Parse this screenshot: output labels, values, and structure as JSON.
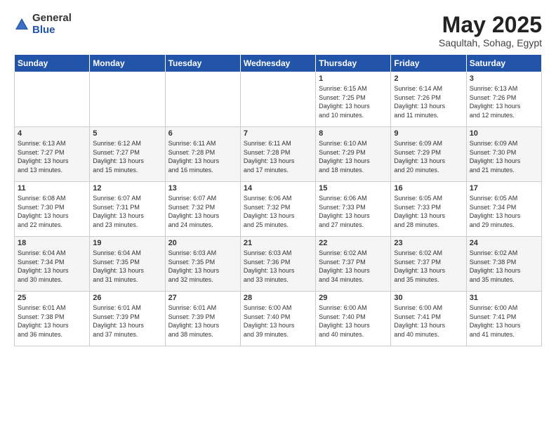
{
  "logo": {
    "general": "General",
    "blue": "Blue"
  },
  "header": {
    "title": "May 2025",
    "location": "Saqultah, Sohag, Egypt"
  },
  "days_of_week": [
    "Sunday",
    "Monday",
    "Tuesday",
    "Wednesday",
    "Thursday",
    "Friday",
    "Saturday"
  ],
  "weeks": [
    [
      {
        "num": "",
        "info": ""
      },
      {
        "num": "",
        "info": ""
      },
      {
        "num": "",
        "info": ""
      },
      {
        "num": "",
        "info": ""
      },
      {
        "num": "1",
        "info": "Sunrise: 6:15 AM\nSunset: 7:25 PM\nDaylight: 13 hours\nand 10 minutes."
      },
      {
        "num": "2",
        "info": "Sunrise: 6:14 AM\nSunset: 7:26 PM\nDaylight: 13 hours\nand 11 minutes."
      },
      {
        "num": "3",
        "info": "Sunrise: 6:13 AM\nSunset: 7:26 PM\nDaylight: 13 hours\nand 12 minutes."
      }
    ],
    [
      {
        "num": "4",
        "info": "Sunrise: 6:13 AM\nSunset: 7:27 PM\nDaylight: 13 hours\nand 13 minutes."
      },
      {
        "num": "5",
        "info": "Sunrise: 6:12 AM\nSunset: 7:27 PM\nDaylight: 13 hours\nand 15 minutes."
      },
      {
        "num": "6",
        "info": "Sunrise: 6:11 AM\nSunset: 7:28 PM\nDaylight: 13 hours\nand 16 minutes."
      },
      {
        "num": "7",
        "info": "Sunrise: 6:11 AM\nSunset: 7:28 PM\nDaylight: 13 hours\nand 17 minutes."
      },
      {
        "num": "8",
        "info": "Sunrise: 6:10 AM\nSunset: 7:29 PM\nDaylight: 13 hours\nand 18 minutes."
      },
      {
        "num": "9",
        "info": "Sunrise: 6:09 AM\nSunset: 7:29 PM\nDaylight: 13 hours\nand 20 minutes."
      },
      {
        "num": "10",
        "info": "Sunrise: 6:09 AM\nSunset: 7:30 PM\nDaylight: 13 hours\nand 21 minutes."
      }
    ],
    [
      {
        "num": "11",
        "info": "Sunrise: 6:08 AM\nSunset: 7:30 PM\nDaylight: 13 hours\nand 22 minutes."
      },
      {
        "num": "12",
        "info": "Sunrise: 6:07 AM\nSunset: 7:31 PM\nDaylight: 13 hours\nand 23 minutes."
      },
      {
        "num": "13",
        "info": "Sunrise: 6:07 AM\nSunset: 7:32 PM\nDaylight: 13 hours\nand 24 minutes."
      },
      {
        "num": "14",
        "info": "Sunrise: 6:06 AM\nSunset: 7:32 PM\nDaylight: 13 hours\nand 25 minutes."
      },
      {
        "num": "15",
        "info": "Sunrise: 6:06 AM\nSunset: 7:33 PM\nDaylight: 13 hours\nand 27 minutes."
      },
      {
        "num": "16",
        "info": "Sunrise: 6:05 AM\nSunset: 7:33 PM\nDaylight: 13 hours\nand 28 minutes."
      },
      {
        "num": "17",
        "info": "Sunrise: 6:05 AM\nSunset: 7:34 PM\nDaylight: 13 hours\nand 29 minutes."
      }
    ],
    [
      {
        "num": "18",
        "info": "Sunrise: 6:04 AM\nSunset: 7:34 PM\nDaylight: 13 hours\nand 30 minutes."
      },
      {
        "num": "19",
        "info": "Sunrise: 6:04 AM\nSunset: 7:35 PM\nDaylight: 13 hours\nand 31 minutes."
      },
      {
        "num": "20",
        "info": "Sunrise: 6:03 AM\nSunset: 7:35 PM\nDaylight: 13 hours\nand 32 minutes."
      },
      {
        "num": "21",
        "info": "Sunrise: 6:03 AM\nSunset: 7:36 PM\nDaylight: 13 hours\nand 33 minutes."
      },
      {
        "num": "22",
        "info": "Sunrise: 6:02 AM\nSunset: 7:37 PM\nDaylight: 13 hours\nand 34 minutes."
      },
      {
        "num": "23",
        "info": "Sunrise: 6:02 AM\nSunset: 7:37 PM\nDaylight: 13 hours\nand 35 minutes."
      },
      {
        "num": "24",
        "info": "Sunrise: 6:02 AM\nSunset: 7:38 PM\nDaylight: 13 hours\nand 35 minutes."
      }
    ],
    [
      {
        "num": "25",
        "info": "Sunrise: 6:01 AM\nSunset: 7:38 PM\nDaylight: 13 hours\nand 36 minutes."
      },
      {
        "num": "26",
        "info": "Sunrise: 6:01 AM\nSunset: 7:39 PM\nDaylight: 13 hours\nand 37 minutes."
      },
      {
        "num": "27",
        "info": "Sunrise: 6:01 AM\nSunset: 7:39 PM\nDaylight: 13 hours\nand 38 minutes."
      },
      {
        "num": "28",
        "info": "Sunrise: 6:00 AM\nSunset: 7:40 PM\nDaylight: 13 hours\nand 39 minutes."
      },
      {
        "num": "29",
        "info": "Sunrise: 6:00 AM\nSunset: 7:40 PM\nDaylight: 13 hours\nand 40 minutes."
      },
      {
        "num": "30",
        "info": "Sunrise: 6:00 AM\nSunset: 7:41 PM\nDaylight: 13 hours\nand 40 minutes."
      },
      {
        "num": "31",
        "info": "Sunrise: 6:00 AM\nSunset: 7:41 PM\nDaylight: 13 hours\nand 41 minutes."
      }
    ]
  ]
}
